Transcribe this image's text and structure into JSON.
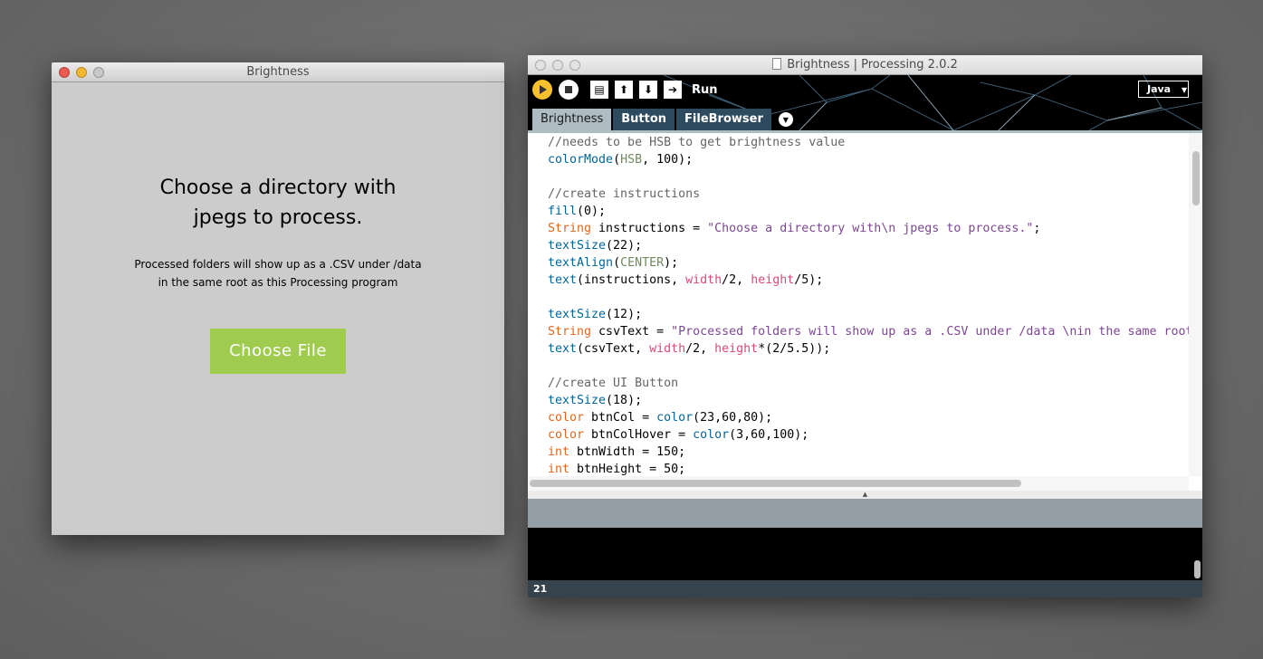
{
  "sketch_window": {
    "title": "Brightness",
    "instructions": "Choose a directory with\njpegs to process.",
    "csv_text": "Processed folders will show up as a .CSV under /data\nin the same root  as this Processing program",
    "button_label": "Choose File",
    "colors": {
      "background": "#cccccc",
      "button": "#9fcc4f"
    }
  },
  "ide_window": {
    "title": "Brightness | Processing 2.0.2",
    "toolbar": {
      "run_label": "Run",
      "mode": "Java",
      "buttons": [
        "run-icon",
        "stop-icon",
        "new-icon",
        "open-icon",
        "save-icon",
        "export-icon"
      ]
    },
    "tabs": [
      {
        "label": "Brightness",
        "active": true
      },
      {
        "label": "Button"
      },
      {
        "label": "FileBrowser"
      }
    ],
    "code_lines": [
      [
        [
          "c",
          "//needs to be HSB to get brightness value"
        ]
      ],
      [
        [
          "f",
          "colorMode"
        ],
        [
          "p",
          "("
        ],
        [
          "n",
          "HSB"
        ],
        [
          "p",
          ", 100);"
        ]
      ],
      [],
      [
        [
          "c",
          "//create instructions"
        ]
      ],
      [
        [
          "f",
          "fill"
        ],
        [
          "p",
          "(0);"
        ]
      ],
      [
        [
          "k",
          "String"
        ],
        [
          "p",
          " instructions = "
        ],
        [
          "s",
          "\"Choose a directory with\\n jpegs to process.\""
        ],
        [
          "p",
          ";"
        ]
      ],
      [
        [
          "f",
          "textSize"
        ],
        [
          "p",
          "(22);"
        ]
      ],
      [
        [
          "f",
          "textAlign"
        ],
        [
          "p",
          "("
        ],
        [
          "n",
          "CENTER"
        ],
        [
          "p",
          ");"
        ]
      ],
      [
        [
          "f",
          "text"
        ],
        [
          "p",
          "(instructions, "
        ],
        [
          "v",
          "width"
        ],
        [
          "p",
          "/2, "
        ],
        [
          "v",
          "height"
        ],
        [
          "p",
          "/5);"
        ]
      ],
      [],
      [
        [
          "f",
          "textSize"
        ],
        [
          "p",
          "(12);"
        ]
      ],
      [
        [
          "k",
          "String"
        ],
        [
          "p",
          " csvText = "
        ],
        [
          "s",
          "\"Processed folders will show up as a .CSV under /data \\nin the same root"
        ]
      ],
      [
        [
          "f",
          "text"
        ],
        [
          "p",
          "(csvText, "
        ],
        [
          "v",
          "width"
        ],
        [
          "p",
          "/2, "
        ],
        [
          "v",
          "height"
        ],
        [
          "p",
          "*(2/5.5));"
        ]
      ],
      [],
      [
        [
          "c",
          "//create UI Button"
        ]
      ],
      [
        [
          "f",
          "textSize"
        ],
        [
          "p",
          "(18);"
        ]
      ],
      [
        [
          "k",
          "color"
        ],
        [
          "p",
          " btnCol = "
        ],
        [
          "f",
          "color"
        ],
        [
          "p",
          "(23,60,80);"
        ]
      ],
      [
        [
          "k",
          "color"
        ],
        [
          "p",
          " btnColHover = "
        ],
        [
          "f",
          "color"
        ],
        [
          "p",
          "(3,60,100);"
        ]
      ],
      [
        [
          "k",
          "int"
        ],
        [
          "p",
          " btnWidth = 150;"
        ]
      ],
      [
        [
          "k",
          "int"
        ],
        [
          "p",
          " btnHeight = 50;"
        ]
      ]
    ],
    "status_line": "21"
  }
}
